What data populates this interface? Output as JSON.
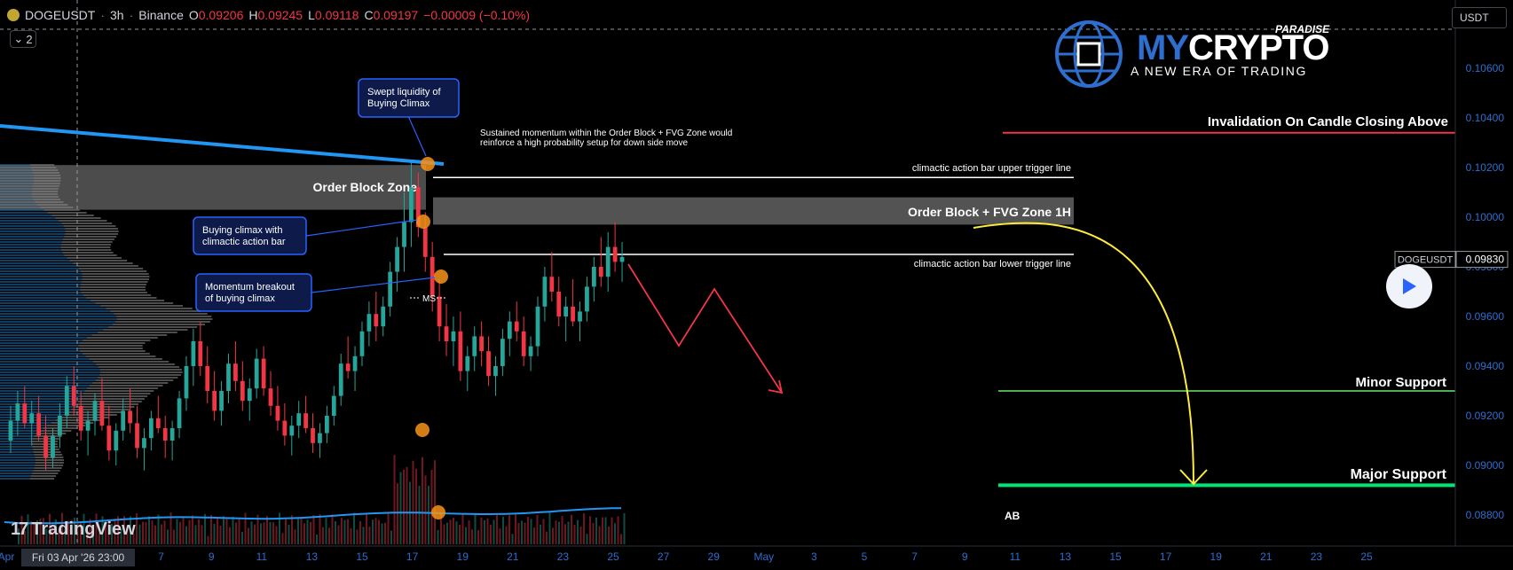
{
  "header": {
    "symbol": "DOGEUSDT",
    "interval": "3h",
    "exchange": "Binance",
    "open_label": "O",
    "open": "0.09206",
    "high_label": "H",
    "high": "0.09245",
    "low_label": "L",
    "low": "0.09118",
    "close_label": "C",
    "close": "0.09197",
    "change": "−0.00009 (−0.10%)"
  },
  "indicator_toggle": "2",
  "currency_button": "USDT",
  "brand": {
    "name_a": "MY",
    "name_b": "CRYPTO",
    "super": "PARADISE",
    "tagline": "A NEW ERA OF TRADING"
  },
  "watermark": "TradingView",
  "colors": {
    "bg": "#000000",
    "up": "#26a69a",
    "down": "#f23645",
    "accent": "#2962ff",
    "trend": "#2196f3",
    "yellow": "#ffeb3b"
  },
  "chart_data": {
    "type": "candlestick",
    "y_axis": {
      "ticks": [
        "0.10600",
        "0.10400",
        "0.10200",
        "0.10000",
        "0.09800",
        "0.09600",
        "0.09400",
        "0.09200",
        "0.09000",
        "0.08800"
      ],
      "ylim": [
        0.0866,
        0.107
      ]
    },
    "x_axis": {
      "ticks": [
        "Apr",
        "7",
        "9",
        "11",
        "13",
        "15",
        "17",
        "19",
        "21",
        "23",
        "25",
        "27",
        "29",
        "May",
        "3",
        "5",
        "7",
        "9",
        "11",
        "13",
        "15",
        "17",
        "19",
        "21",
        "23",
        "25"
      ],
      "crosshair_label": "Fri 03 Apr '26  23:00"
    },
    "last_price": {
      "label": "DOGEUSDT",
      "value": "0.09830",
      "y": 0.0983
    },
    "levels": [
      {
        "name": "invalidation",
        "label": "Invalidation On Candle Closing Above",
        "y": 0.1034,
        "color": "#f23645"
      },
      {
        "name": "upper-trigger",
        "label": "climactic action bar upper trigger line",
        "y": 0.1016,
        "color": "#ffffff"
      },
      {
        "name": "lower-trigger",
        "label": "climactic action bar lower trigger line",
        "y": 0.0985,
        "color": "#ffffff"
      },
      {
        "name": "minor-support",
        "label": "Minor Support",
        "y": 0.093,
        "color": "#4caf50"
      },
      {
        "name": "major-support",
        "label": "Major Support",
        "y": 0.0892,
        "color": "#00e676"
      }
    ],
    "zones": [
      {
        "name": "order-block-zone",
        "label": "Order Block Zone",
        "y1": 0.1003,
        "y2": 0.1021
      },
      {
        "name": "fvg-zone",
        "label": "Order Block + FVG Zone 1H",
        "y1": 0.0997,
        "y2": 0.1008
      }
    ],
    "callouts": [
      {
        "name": "swept-liquidity",
        "text1": "Swept liquidity of",
        "text2": "Buying Climax"
      },
      {
        "name": "buying-climax",
        "text1": "Buying climax with",
        "text2": "climactic action bar"
      },
      {
        "name": "momentum-breakout",
        "text1": "Momentum breakout",
        "text2": "of buying climax"
      }
    ],
    "note1": "Sustained momentum within the Order Block + FVG Zone would",
    "note2": "reinforce a high probability setup for down side move",
    "ms_label": "MS",
    "ab_label": "AB",
    "candles": [
      [
        0.091,
        0.0924,
        0.0905,
        0.0918
      ],
      [
        0.0918,
        0.093,
        0.0912,
        0.0925
      ],
      [
        0.0925,
        0.0932,
        0.0915,
        0.0917
      ],
      [
        0.0917,
        0.0926,
        0.0908,
        0.0921
      ],
      [
        0.0921,
        0.0928,
        0.091,
        0.0912
      ],
      [
        0.0912,
        0.092,
        0.0898,
        0.0903
      ],
      [
        0.0903,
        0.0915,
        0.0899,
        0.0912
      ],
      [
        0.0912,
        0.0925,
        0.0907,
        0.092
      ],
      [
        0.092,
        0.0936,
        0.0915,
        0.0932
      ],
      [
        0.0932,
        0.094,
        0.092,
        0.0924
      ],
      [
        0.0924,
        0.093,
        0.091,
        0.0914
      ],
      [
        0.0914,
        0.0922,
        0.0904,
        0.0918
      ],
      [
        0.0918,
        0.0929,
        0.0912,
        0.0926
      ],
      [
        0.0926,
        0.0935,
        0.0914,
        0.0916
      ],
      [
        0.0916,
        0.0924,
        0.0902,
        0.0906
      ],
      [
        0.0906,
        0.0917,
        0.09,
        0.0914
      ],
      [
        0.0914,
        0.0927,
        0.091,
        0.0922
      ],
      [
        0.0922,
        0.0931,
        0.0913,
        0.0917
      ],
      [
        0.0917,
        0.0924,
        0.0903,
        0.0907
      ],
      [
        0.0907,
        0.0915,
        0.0898,
        0.0911
      ],
      [
        0.0911,
        0.0922,
        0.0906,
        0.0919
      ],
      [
        0.0919,
        0.0928,
        0.0913,
        0.0915
      ],
      [
        0.0915,
        0.092,
        0.0903,
        0.091
      ],
      [
        0.091,
        0.0918,
        0.0902,
        0.0915
      ],
      [
        0.0915,
        0.093,
        0.0911,
        0.0927
      ],
      [
        0.0927,
        0.0944,
        0.0922,
        0.094
      ],
      [
        0.094,
        0.0955,
        0.0932,
        0.095
      ],
      [
        0.095,
        0.0958,
        0.0936,
        0.094
      ],
      [
        0.094,
        0.0948,
        0.0925,
        0.093
      ],
      [
        0.093,
        0.0938,
        0.0918,
        0.0922
      ],
      [
        0.0922,
        0.0934,
        0.0916,
        0.093
      ],
      [
        0.093,
        0.0945,
        0.0925,
        0.0941
      ],
      [
        0.0941,
        0.095,
        0.093,
        0.0934
      ],
      [
        0.0934,
        0.0942,
        0.0922,
        0.0926
      ],
      [
        0.0926,
        0.0935,
        0.0918,
        0.0931
      ],
      [
        0.0931,
        0.0947,
        0.0927,
        0.0943
      ],
      [
        0.0943,
        0.0948,
        0.0928,
        0.0931
      ],
      [
        0.0931,
        0.0938,
        0.092,
        0.0924
      ],
      [
        0.0924,
        0.0932,
        0.0914,
        0.0918
      ],
      [
        0.0918,
        0.0925,
        0.0908,
        0.0912
      ],
      [
        0.0912,
        0.092,
        0.0904,
        0.0916
      ],
      [
        0.0916,
        0.0926,
        0.0911,
        0.0921
      ],
      [
        0.0921,
        0.0928,
        0.0913,
        0.0915
      ],
      [
        0.0915,
        0.0921,
        0.0905,
        0.0909
      ],
      [
        0.0909,
        0.0917,
        0.0903,
        0.0913
      ],
      [
        0.0913,
        0.0924,
        0.0909,
        0.092
      ],
      [
        0.092,
        0.0932,
        0.0916,
        0.0928
      ],
      [
        0.0928,
        0.0945,
        0.0924,
        0.0941
      ],
      [
        0.0941,
        0.0952,
        0.0935,
        0.0938
      ],
      [
        0.0938,
        0.0948,
        0.093,
        0.0944
      ],
      [
        0.0944,
        0.0958,
        0.094,
        0.0954
      ],
      [
        0.0954,
        0.0966,
        0.0948,
        0.0961
      ],
      [
        0.0961,
        0.097,
        0.095,
        0.0956
      ],
      [
        0.0956,
        0.0968,
        0.0952,
        0.0964
      ],
      [
        0.0964,
        0.0982,
        0.096,
        0.0978
      ],
      [
        0.0978,
        0.0992,
        0.097,
        0.0988
      ],
      [
        0.0988,
        0.101,
        0.0978,
        0.0998
      ],
      [
        0.0998,
        0.1022,
        0.0988,
        0.1012
      ],
      [
        0.1012,
        0.1018,
        0.0992,
        0.0996
      ],
      [
        0.0996,
        0.1002,
        0.0978,
        0.0984
      ],
      [
        0.0984,
        0.099,
        0.0962,
        0.0968
      ],
      [
        0.0968,
        0.0975,
        0.095,
        0.0956
      ],
      [
        0.0956,
        0.0965,
        0.0944,
        0.095
      ],
      [
        0.095,
        0.096,
        0.094,
        0.0954
      ],
      [
        0.0954,
        0.0962,
        0.0934,
        0.0938
      ],
      [
        0.0938,
        0.0948,
        0.093,
        0.0944
      ],
      [
        0.0944,
        0.0956,
        0.0938,
        0.0952
      ],
      [
        0.0952,
        0.0958,
        0.094,
        0.0946
      ],
      [
        0.0946,
        0.0952,
        0.0932,
        0.0936
      ],
      [
        0.0936,
        0.0944,
        0.0928,
        0.094
      ],
      [
        0.094,
        0.0955,
        0.0936,
        0.0951
      ],
      [
        0.0951,
        0.0962,
        0.0944,
        0.0958
      ],
      [
        0.0958,
        0.0966,
        0.095,
        0.0954
      ],
      [
        0.0954,
        0.096,
        0.094,
        0.0944
      ],
      [
        0.0944,
        0.0952,
        0.0938,
        0.0948
      ],
      [
        0.0948,
        0.0968,
        0.0944,
        0.0964
      ],
      [
        0.0964,
        0.098,
        0.0958,
        0.0976
      ],
      [
        0.0976,
        0.0986,
        0.0966,
        0.097
      ],
      [
        0.097,
        0.0976,
        0.0956,
        0.096
      ],
      [
        0.096,
        0.0968,
        0.095,
        0.0964
      ],
      [
        0.0964,
        0.0975,
        0.0956,
        0.0958
      ],
      [
        0.0958,
        0.0966,
        0.095,
        0.0962
      ],
      [
        0.0962,
        0.0976,
        0.0958,
        0.0972
      ],
      [
        0.0972,
        0.0984,
        0.0966,
        0.098
      ],
      [
        0.098,
        0.0992,
        0.0972,
        0.0976
      ],
      [
        0.0976,
        0.0994,
        0.097,
        0.0988
      ],
      [
        0.0988,
        0.0998,
        0.0978,
        0.0982
      ],
      [
        0.0982,
        0.099,
        0.0974,
        0.0984
      ]
    ],
    "volume_ma": [
      0.0,
      1
    ]
  }
}
